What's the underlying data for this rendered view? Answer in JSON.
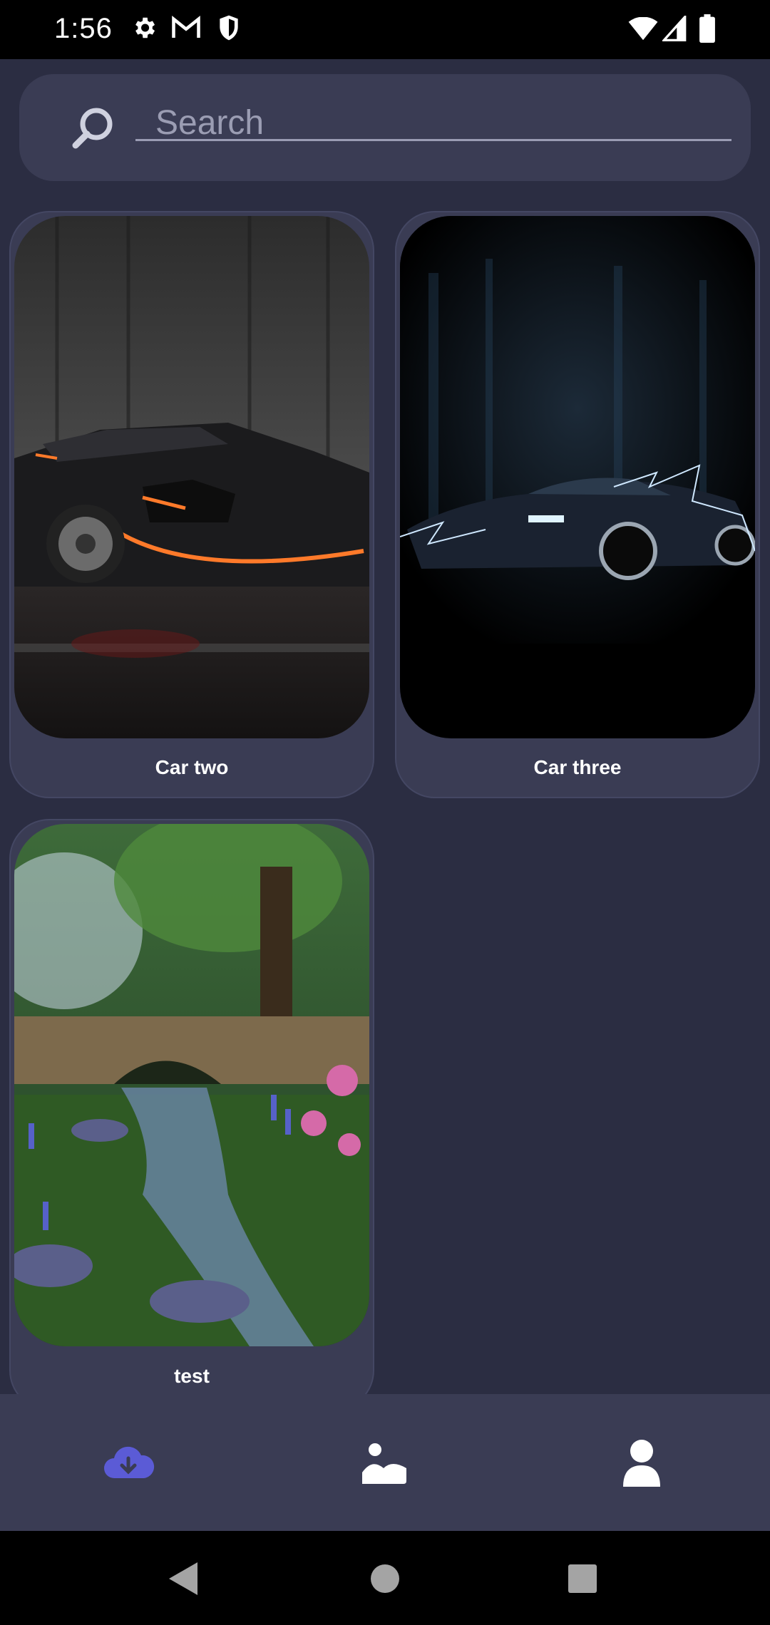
{
  "status_bar": {
    "time": "1:56",
    "icons_left": [
      "gear-icon",
      "gmail-icon",
      "shield-icon"
    ],
    "icons_right": [
      "wifi-icon",
      "signal-icon",
      "battery-icon"
    ]
  },
  "search": {
    "placeholder": "Search",
    "icon": "search-icon"
  },
  "gallery": {
    "items": [
      {
        "label": "Car two",
        "image": "black sports sedan with orange headlight trim"
      },
      {
        "label": "Car three",
        "image": "dark sports car with blue lightning"
      },
      {
        "label": "test",
        "image": "forest stream with stone bridge and flowers"
      }
    ]
  },
  "bottom_nav": {
    "items": [
      {
        "icon": "cloud-download-icon",
        "active": true
      },
      {
        "icon": "gallery-icon",
        "active": false
      },
      {
        "icon": "profile-icon",
        "active": false
      }
    ],
    "active_color": "#5b5bd6",
    "inactive_color": "#ffffff"
  },
  "system_nav": {
    "buttons": [
      "back-button",
      "home-button",
      "recents-button"
    ]
  },
  "colors": {
    "background": "#2b2d42",
    "surface": "#3a3c54",
    "accent": "#5b5bd6"
  }
}
